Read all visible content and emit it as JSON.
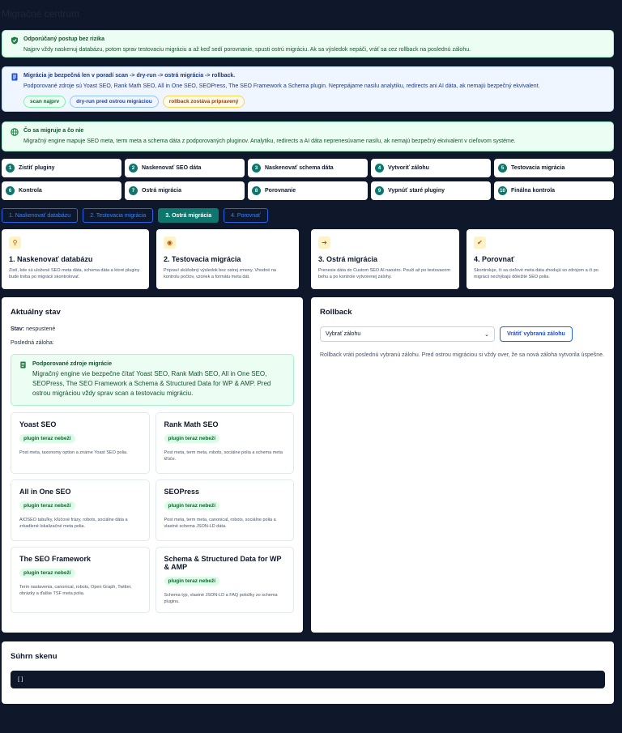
{
  "page_title": "Migračné centrum",
  "alerts": {
    "risk": {
      "title": "Odporúčaný postup bez rizika",
      "text": "Najprv vždy naskenuj databázu, potom sprav testovaciu migráciu a až keď sedí porovnanie, spusti ostrú migráciu. Ak sa výsledok nepáči, vráť sa cez rollback na poslednú zálohu."
    },
    "order": {
      "title": "Migrácia je bezpečná len v poradí scan -> dry-run -> ostrá migrácia -> rollback.",
      "text": "Podporované zdroje sú Yoast SEO, Rank Math SEO, All in One SEO, SEOPress, The SEO Framework a Schema plugin. Neprepájame nasilu analytiku, redirects ani AI dáta, ak nemajú bezpečný ekvivalent.",
      "chips": [
        "scan najprv",
        "dry-run pred ostrou migráciou",
        "rollback zostáva pripravený"
      ]
    },
    "scope": {
      "title": "Čo sa migruje a čo nie",
      "text": "Migračný engine mapuje SEO meta, term meta a schema dáta z podporovaných pluginov. Analytiku, redirects a AI dáta neprenesúvame nasilu, ak nemajú bezpečný ekvivalent v cieľovom systéme."
    }
  },
  "steps": [
    "Zistiť pluginy",
    "Naskenovať SEO dáta",
    "Naskenovať schema dáta",
    "Vytvoriť zálohu",
    "Testovacia migrácia",
    "Kontrola",
    "Ostrá migrácia",
    "Porovnanie",
    "Vypnúť staré pluginy",
    "Finálna kontrola"
  ],
  "tabs": [
    "1. Naskenovať databázu",
    "2. Testovacia migrácia",
    "3. Ostrá migrácia",
    "4. Porovnať"
  ],
  "active_tab": 2,
  "cards": [
    {
      "icon": "search-icon",
      "title": "1. Naskenovať databázu",
      "text": "Zistí, kde sú uložené SEO meta dáta, schema dáta a ktoré pluginy bude treba po migrácii skontrolovať."
    },
    {
      "icon": "eye-icon",
      "title": "2. Testovacia migrácia",
      "text": "Pripraví skúšobný výsledok bez ostrej zmeny. Vhodné na kontrolu počtov, vzoriek a formátu meta dát."
    },
    {
      "icon": "migrate-icon",
      "title": "3. Ostrá migrácia",
      "text": "Prenesie dáta do Custom SEO AI naostro. Použi až po testovacom behu a po kontrole vytvorenej zálohy."
    },
    {
      "icon": "check-icon",
      "title": "4. Porovnať",
      "text": "Skontroluje, či sa cieľové meta dáta zhodujú so zdrojom a či po migrácii nechýbajú dôležité SEO polia."
    }
  ],
  "status": {
    "heading": "Aktuálny stav",
    "state_label": "Stav:",
    "state_value": "nespustené",
    "backup_label": "Posledná záloha:",
    "sources_title": "Podporované zdroje migrácie",
    "sources_text": "Migračný engine vie bezpečne čítať Yoast SEO, Rank Math SEO, All in One SEO, SEOPress, The SEO Framework a Schema & Structured Data for WP & AMP. Pred ostrou migráciou vždy sprav scan a testovaciu migráciu.",
    "plugins": [
      {
        "name": "Yoast SEO",
        "badge": "plugin teraz nebeží",
        "text": "Post meta, taxonomy option a známe Yoast SEO polia."
      },
      {
        "name": "Rank Math SEO",
        "badge": "plugin teraz nebeží",
        "text": "Post meta, term meta, robots, sociálne polia a schema meta kľúče."
      },
      {
        "name": "All in One SEO",
        "badge": "plugin teraz nebeží",
        "text": "AIOSEO tabuľky, kľúčové frázy, robots, sociálne dáta a zrkadlené lokalizačné meta polia."
      },
      {
        "name": "SEOPress",
        "badge": "plugin teraz nebeží",
        "text": "Post meta, term meta, canonical, robots, sociálne polia a vlastné schema JSON-LD dáta."
      },
      {
        "name": "The SEO Framework",
        "badge": "plugin teraz nebeží",
        "text": "Term nastavenia, canonical, robots, Open Graph, Twitter, obrázky a ďalšie TSF meta polia."
      },
      {
        "name": "Schema & Structured Data for WP & AMP",
        "badge": "plugin teraz nebeží",
        "text": "Schema typ, vlastné JSON-LD a FAQ položky zo schema pluginu."
      }
    ]
  },
  "rollback": {
    "heading": "Rollback",
    "select_value": "Vybrať zálohu",
    "button": "Vrátiť vybranú zálohu",
    "text": "Rollback vráti poslednú vybranú zálohu. Pred ostrou migráciou si vždy over, že sa nová záloha vytvorila úspešne."
  },
  "summary": {
    "heading": "Súhrn skenu",
    "code": "[]"
  }
}
